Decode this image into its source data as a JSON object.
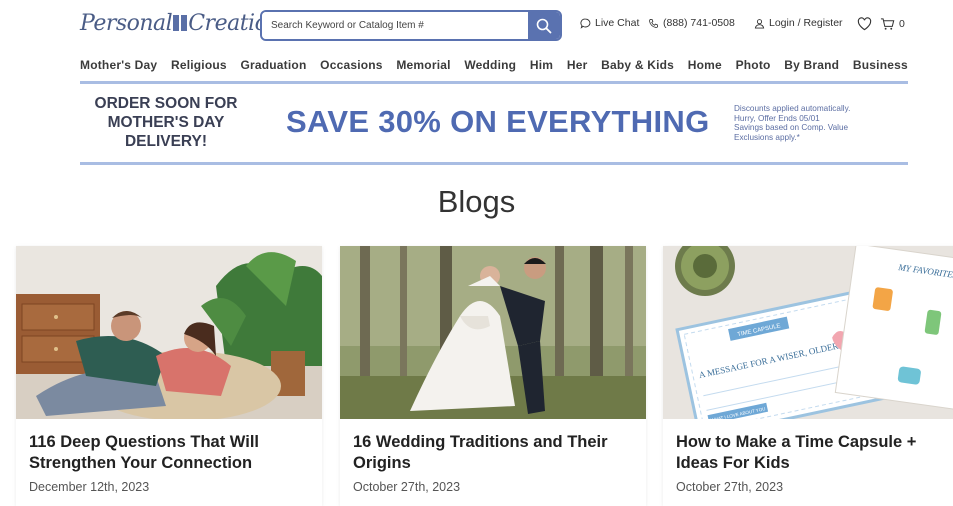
{
  "header": {
    "logo_text_1": "Personal",
    "logo_text_2": "Creations",
    "search_placeholder": "Search Keyword or Catalog Item #",
    "live_chat": "Live Chat",
    "phone": "(888) 741-0508",
    "login": "Login / Register",
    "cart_count": "0"
  },
  "nav": {
    "items": [
      "Mother's Day",
      "Religious",
      "Graduation",
      "Occasions",
      "Memorial",
      "Wedding",
      "Him",
      "Her",
      "Baby & Kids",
      "Home",
      "Photo",
      "By Brand",
      "Business"
    ]
  },
  "promo": {
    "left_line1": "ORDER SOON FOR",
    "left_line2": "MOTHER'S DAY",
    "left_line3": "DELIVERY!",
    "headline": "SAVE 30% ON EVERYTHING",
    "fine1": "Discounts applied automatically.",
    "fine2": "Hurry, Offer Ends 05/01",
    "fine3": "Savings based on Comp. Value",
    "fine4": "Exclusions apply.*"
  },
  "page_title": "Blogs",
  "cards": [
    {
      "title": "116 Deep Questions That Will Strengthen Your Connection",
      "date": "December 12th, 2023"
    },
    {
      "title": "16 Wedding Traditions and Their Origins",
      "date": "October 27th, 2023"
    },
    {
      "title": "How to Make a Time Capsule + Ideas For Kids",
      "date": "October 27th, 2023"
    }
  ],
  "card_image_text": {
    "capsule_label": "TIME CAPSULE",
    "capsule_message": "A MESSAGE FOR A WISER, OLDER YOU",
    "capsule_sub": "WHAT I LOVE ABOUT YOU",
    "favorites": "MY FAVORITES"
  },
  "colors": {
    "brand": "#5a72b0",
    "promo_headline": "#4f6ab2",
    "promo_border": "#a9bde3"
  }
}
